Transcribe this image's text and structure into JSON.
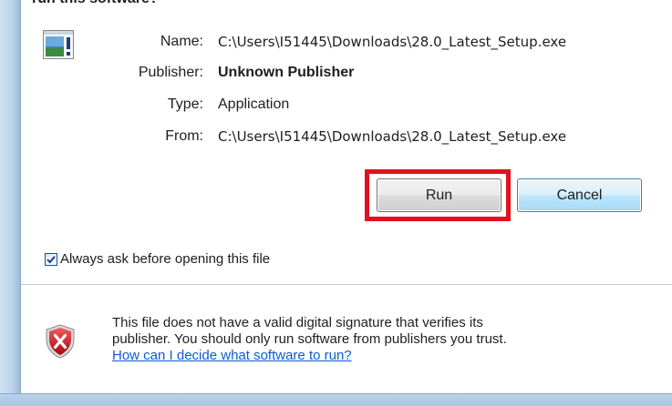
{
  "dialog": {
    "question": "run this software?",
    "fields": {
      "name_label": "Name:",
      "name_value": "C:\\Users\\I51445\\Downloads\\28.0_Latest_Setup.exe",
      "publisher_label": "Publisher:",
      "publisher_value": "Unknown Publisher",
      "type_label": "Type:",
      "type_value": "Application",
      "from_label": "From:",
      "from_value": "C:\\Users\\I51445\\Downloads\\28.0_Latest_Setup.exe"
    },
    "buttons": {
      "run_label": "Run",
      "cancel_label": "Cancel"
    },
    "checkbox": {
      "label": "Always ask before opening this file",
      "checked": true
    },
    "warning": {
      "line1": "This file does not have a valid digital signature that verifies its",
      "line2": "publisher.  You should only run software from publishers you trust.",
      "link": "How can I decide what software to run?"
    },
    "icons": {
      "app": "application-icon",
      "warning": "security-warning-shield-icon",
      "check": "checkmark-icon"
    },
    "colors": {
      "highlight": "#e3101e",
      "link": "#0b5bd3",
      "shield": "#c8161d"
    }
  }
}
